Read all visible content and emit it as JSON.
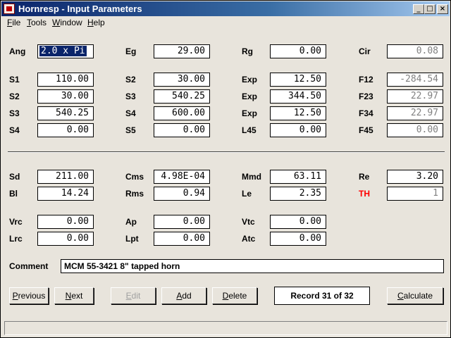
{
  "window": {
    "title": "Hornresp - Input Parameters",
    "controls": {
      "minimize": "_",
      "maximize": "□",
      "close": "×"
    }
  },
  "menu": [
    "File",
    "Tools",
    "Window",
    "Help"
  ],
  "params": {
    "ang": {
      "label": "Ang",
      "value": "2.0 x Pi"
    },
    "eg": {
      "label": "Eg",
      "value": "29.00"
    },
    "rg": {
      "label": "Rg",
      "value": "0.00"
    },
    "cir": {
      "label": "Cir",
      "value": "0.08"
    },
    "s1": {
      "label": "S1",
      "value": "110.00"
    },
    "s2a": {
      "label": "S2",
      "value": "30.00"
    },
    "exp1": {
      "label": "Exp",
      "value": "12.50"
    },
    "f12": {
      "label": "F12",
      "value": "-284.54"
    },
    "s2b": {
      "label": "S2",
      "value": "30.00"
    },
    "s3a": {
      "label": "S3",
      "value": "540.25"
    },
    "exp2": {
      "label": "Exp",
      "value": "344.50"
    },
    "f23": {
      "label": "F23",
      "value": "22.97"
    },
    "s3b": {
      "label": "S3",
      "value": "540.25"
    },
    "s4a": {
      "label": "S4",
      "value": "600.00"
    },
    "exp3": {
      "label": "Exp",
      "value": "12.50"
    },
    "f34": {
      "label": "F34",
      "value": "22.97"
    },
    "s4b": {
      "label": "S4",
      "value": "0.00"
    },
    "s5": {
      "label": "S5",
      "value": "0.00"
    },
    "l45": {
      "label": "L45",
      "value": "0.00"
    },
    "f45": {
      "label": "F45",
      "value": "0.00"
    },
    "sd": {
      "label": "Sd",
      "value": "211.00"
    },
    "cms": {
      "label": "Cms",
      "value": "4.98E-04"
    },
    "mmd": {
      "label": "Mmd",
      "value": "63.11"
    },
    "re": {
      "label": "Re",
      "value": "3.20"
    },
    "bl": {
      "label": "Bl",
      "value": "14.24"
    },
    "rms": {
      "label": "Rms",
      "value": "0.94"
    },
    "le": {
      "label": "Le",
      "value": "2.35"
    },
    "th": {
      "label": "TH",
      "value": "1"
    },
    "vrc": {
      "label": "Vrc",
      "value": "0.00"
    },
    "ap": {
      "label": "Ap",
      "value": "0.00"
    },
    "vtc": {
      "label": "Vtc",
      "value": "0.00"
    },
    "lrc": {
      "label": "Lrc",
      "value": "0.00"
    },
    "lpt": {
      "label": "Lpt",
      "value": "0.00"
    },
    "atc": {
      "label": "Atc",
      "value": "0.00"
    }
  },
  "comment": {
    "label": "Comment",
    "value": "MCM 55-3421 8\" tapped horn"
  },
  "buttons": {
    "previous": {
      "pre": "",
      "acc": "P",
      "post": "revious"
    },
    "next": {
      "pre": "",
      "acc": "N",
      "post": "ext"
    },
    "edit": {
      "pre": "",
      "acc": "E",
      "post": "dit"
    },
    "add": {
      "pre": "",
      "acc": "A",
      "post": "dd"
    },
    "delete": {
      "pre": "",
      "acc": "D",
      "post": "elete"
    },
    "calculate": {
      "pre": "",
      "acc": "C",
      "post": "alculate"
    }
  },
  "record": "Record 31 of 32",
  "colors": {
    "th_label": "#ff0000",
    "title_bar": "#0a246a",
    "readonly_text": "#808080"
  }
}
